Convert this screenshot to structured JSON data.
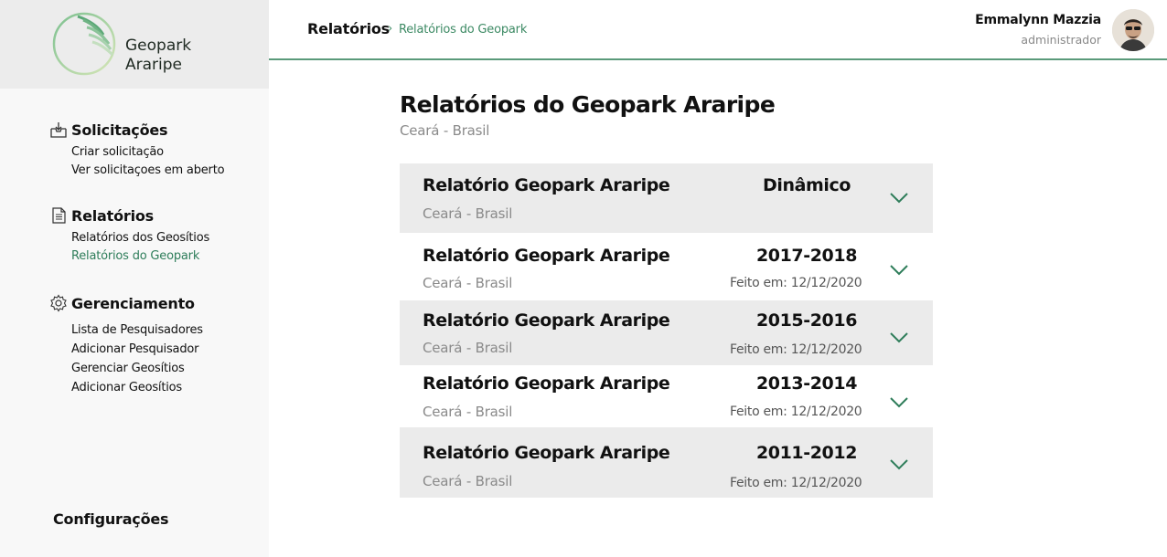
{
  "brand": {
    "name_line1": "Geopark",
    "name_line2": "Araripe",
    "accent": "#2e7d5a"
  },
  "sidebar": {
    "sections": [
      {
        "icon": "inbox-download-icon",
        "label": "Solicitações",
        "links": [
          "Criar solicitação",
          "Ver solicitaçoes em aberto"
        ]
      },
      {
        "icon": "document-icon",
        "label": "Relatórios",
        "links": [
          "Relatórios dos Geosítios",
          "Relatórios do Geopark"
        ]
      },
      {
        "icon": "gear-icon",
        "label": "Gerenciamento",
        "links": [
          "Lista de Pesquisadores",
          "Adicionar Pesquisador",
          "Gerenciar Geosítios",
          "Adicionar Geosítios"
        ]
      }
    ],
    "active_link": "Relatórios do Geopark",
    "settings_label": "Configurações"
  },
  "header": {
    "breadcrumb_main": "Relatórios",
    "breadcrumb_sep": "›",
    "breadcrumb_sub": "Relatórios do Geopark",
    "user_name": "Emmalynn Mazzia",
    "user_role": "administrador"
  },
  "main": {
    "title": "Relatórios do Geopark Araripe",
    "subtitle": "Ceará - Brasil",
    "reports": [
      {
        "title": "Relatório Geopark Araripe",
        "subtitle": "Ceará - Brasil",
        "period": "Dinâmico",
        "date": ""
      },
      {
        "title": "Relatório Geopark Araripe",
        "subtitle": "Ceará - Brasil",
        "period": "2017-2018",
        "date": "Feito em: 12/12/2020"
      },
      {
        "title": "Relatório Geopark Araripe",
        "subtitle": "Ceará - Brasil",
        "period": "2015-2016",
        "date": "Feito em: 12/12/2020"
      },
      {
        "title": "Relatório Geopark Araripe",
        "subtitle": "Ceará - Brasil",
        "period": "2013-2014",
        "date": "Feito em: 12/12/2020"
      },
      {
        "title": "Relatório Geopark Araripe",
        "subtitle": "Ceará - Brasil",
        "period": "2011-2012",
        "date": "Feito em: 12/12/2020"
      }
    ]
  }
}
